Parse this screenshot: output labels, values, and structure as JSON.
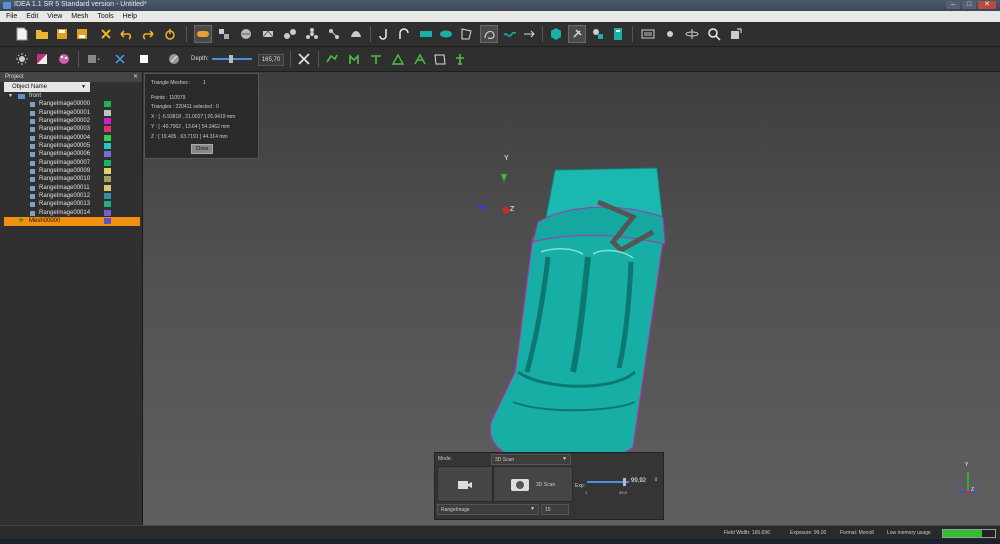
{
  "window": {
    "title": "IDEA 1.1 SR 5 Standard version - Untitled*"
  },
  "menu": [
    "File",
    "Edit",
    "View",
    "Mesh",
    "Tools",
    "Help"
  ],
  "toolbar2": {
    "depth_label": "Depth:",
    "depth_value": "165,70"
  },
  "project": {
    "header": "Project",
    "column": "Object Name",
    "root": "front",
    "items": [
      {
        "label": "RangeImage00000",
        "color": "#21b04a"
      },
      {
        "label": "RangeImage00001",
        "color": "#c0c0c0"
      },
      {
        "label": "RangeImage00002",
        "color": "#d020c8"
      },
      {
        "label": "RangeImage00003",
        "color": "#e03070"
      },
      {
        "label": "RangeImage00004",
        "color": "#30d050"
      },
      {
        "label": "RangeImage00005",
        "color": "#30c0c8"
      },
      {
        "label": "RangeImage00006",
        "color": "#7070d0"
      },
      {
        "label": "RangeImage00007",
        "color": "#20b060"
      },
      {
        "label": "RangeImage00009",
        "color": "#e0d070"
      },
      {
        "label": "RangeImage00010",
        "color": "#a0a060"
      },
      {
        "label": "RangeImage00011",
        "color": "#d8c870"
      },
      {
        "label": "RangeImage00012",
        "color": "#3090b0"
      },
      {
        "label": "RangeImage00013",
        "color": "#20b080"
      },
      {
        "label": "RangeImage00014",
        "color": "#7060d8"
      }
    ],
    "mesh": {
      "label": "Mesh00000",
      "color": "#6050c8"
    }
  },
  "info": {
    "title": "Triangle Meshes :",
    "title_value": "1",
    "points": "Points :     110979",
    "triangles": "Triangles :  220411  selected :   0",
    "x": "X : [ -5.93818 , 21.0027 ]  26.9419 mm",
    "y": "Y : [ -40.7062 , 13.64 ]   54.3462 mm",
    "z": "Z : [ 19.405 , 63.7191 ]   44.314 mm",
    "close": "Close"
  },
  "viewport": {
    "axis_y": "Y",
    "axis_z": "Z",
    "colors": {
      "mesh": "#18b8b0",
      "mesh_dark": "#0e7e78",
      "edge": "#b030b0"
    }
  },
  "scan": {
    "mode_label": "Mode:",
    "mode_value": "3D Scan",
    "button_label": "3D Scan",
    "exp_label": "Exp:",
    "exp_value": "99,92",
    "slider_min": "1",
    "slider_max": "99,9",
    "range_label": "RangeImage",
    "range_count": "15"
  },
  "status": {
    "field_width": "Field Width: 165.696",
    "exposure": "Exposure: 99.92",
    "format": "Format: Mono8",
    "memory": "Low memory usage"
  }
}
